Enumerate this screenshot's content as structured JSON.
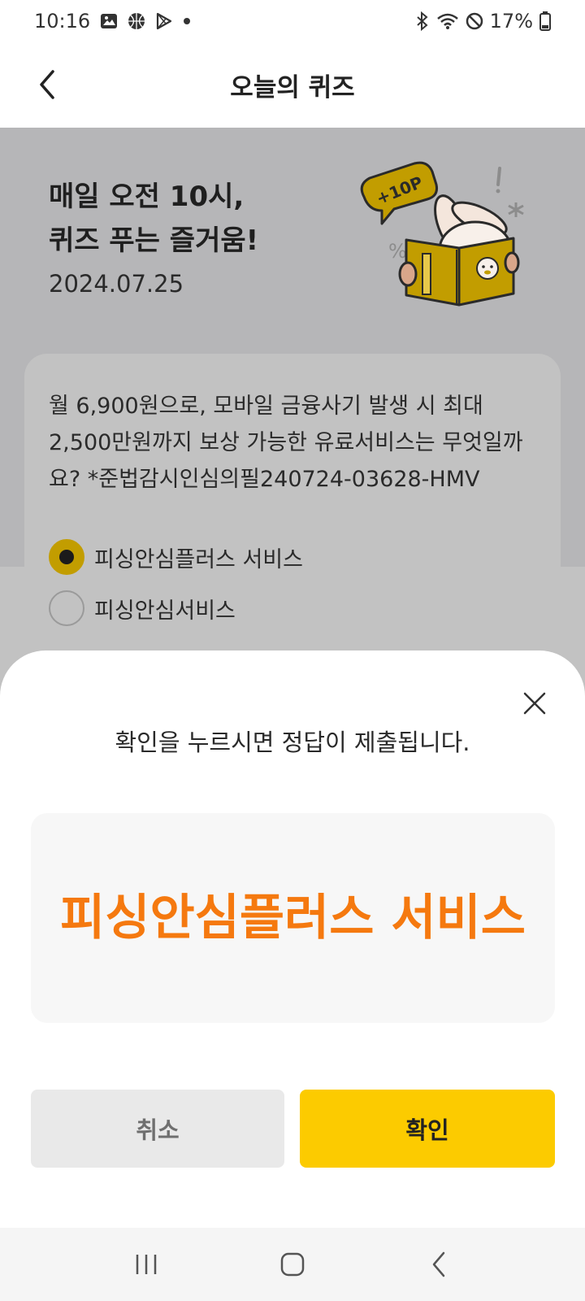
{
  "status_bar": {
    "time": "10:16",
    "battery": "17%",
    "icons": [
      "gallery-icon",
      "basketball-icon",
      "play-store-icon",
      "dot-icon",
      "bluetooth-icon",
      "wifi-icon",
      "do-not-disturb-icon",
      "battery-icon"
    ]
  },
  "header": {
    "title": "오늘의 퀴즈",
    "back_icon": "back-arrow-icon"
  },
  "hero": {
    "title": "매일 오전 10시,\n퀴즈 푸는 즐거움!",
    "date": "2024.07.25",
    "badge": "+10P"
  },
  "question": {
    "text": "월 6,900원으로, 모바일 금융사기 발생 시 최대 2,500만원까지 보상 가능한 유료서비스는 무엇일까요? *준법감시인심의필240724-03628-HMV",
    "options": [
      {
        "label": "피싱안심플러스 서비스",
        "selected": true
      },
      {
        "label": "피싱안심서비스",
        "selected": false
      }
    ]
  },
  "sheet": {
    "message": "확인을 누르시면 정답이 제출됩니다.",
    "answer": "피싱안심플러스 서비스",
    "cancel_label": "취소",
    "confirm_label": "확인",
    "close_icon": "close-icon"
  },
  "colors": {
    "accent": "#fccb00",
    "answer": "#f5790f",
    "dim_overlay": "#b6b6b8"
  },
  "nav_bar": {
    "icons": [
      "recent-apps-icon",
      "home-icon",
      "back-icon"
    ]
  }
}
